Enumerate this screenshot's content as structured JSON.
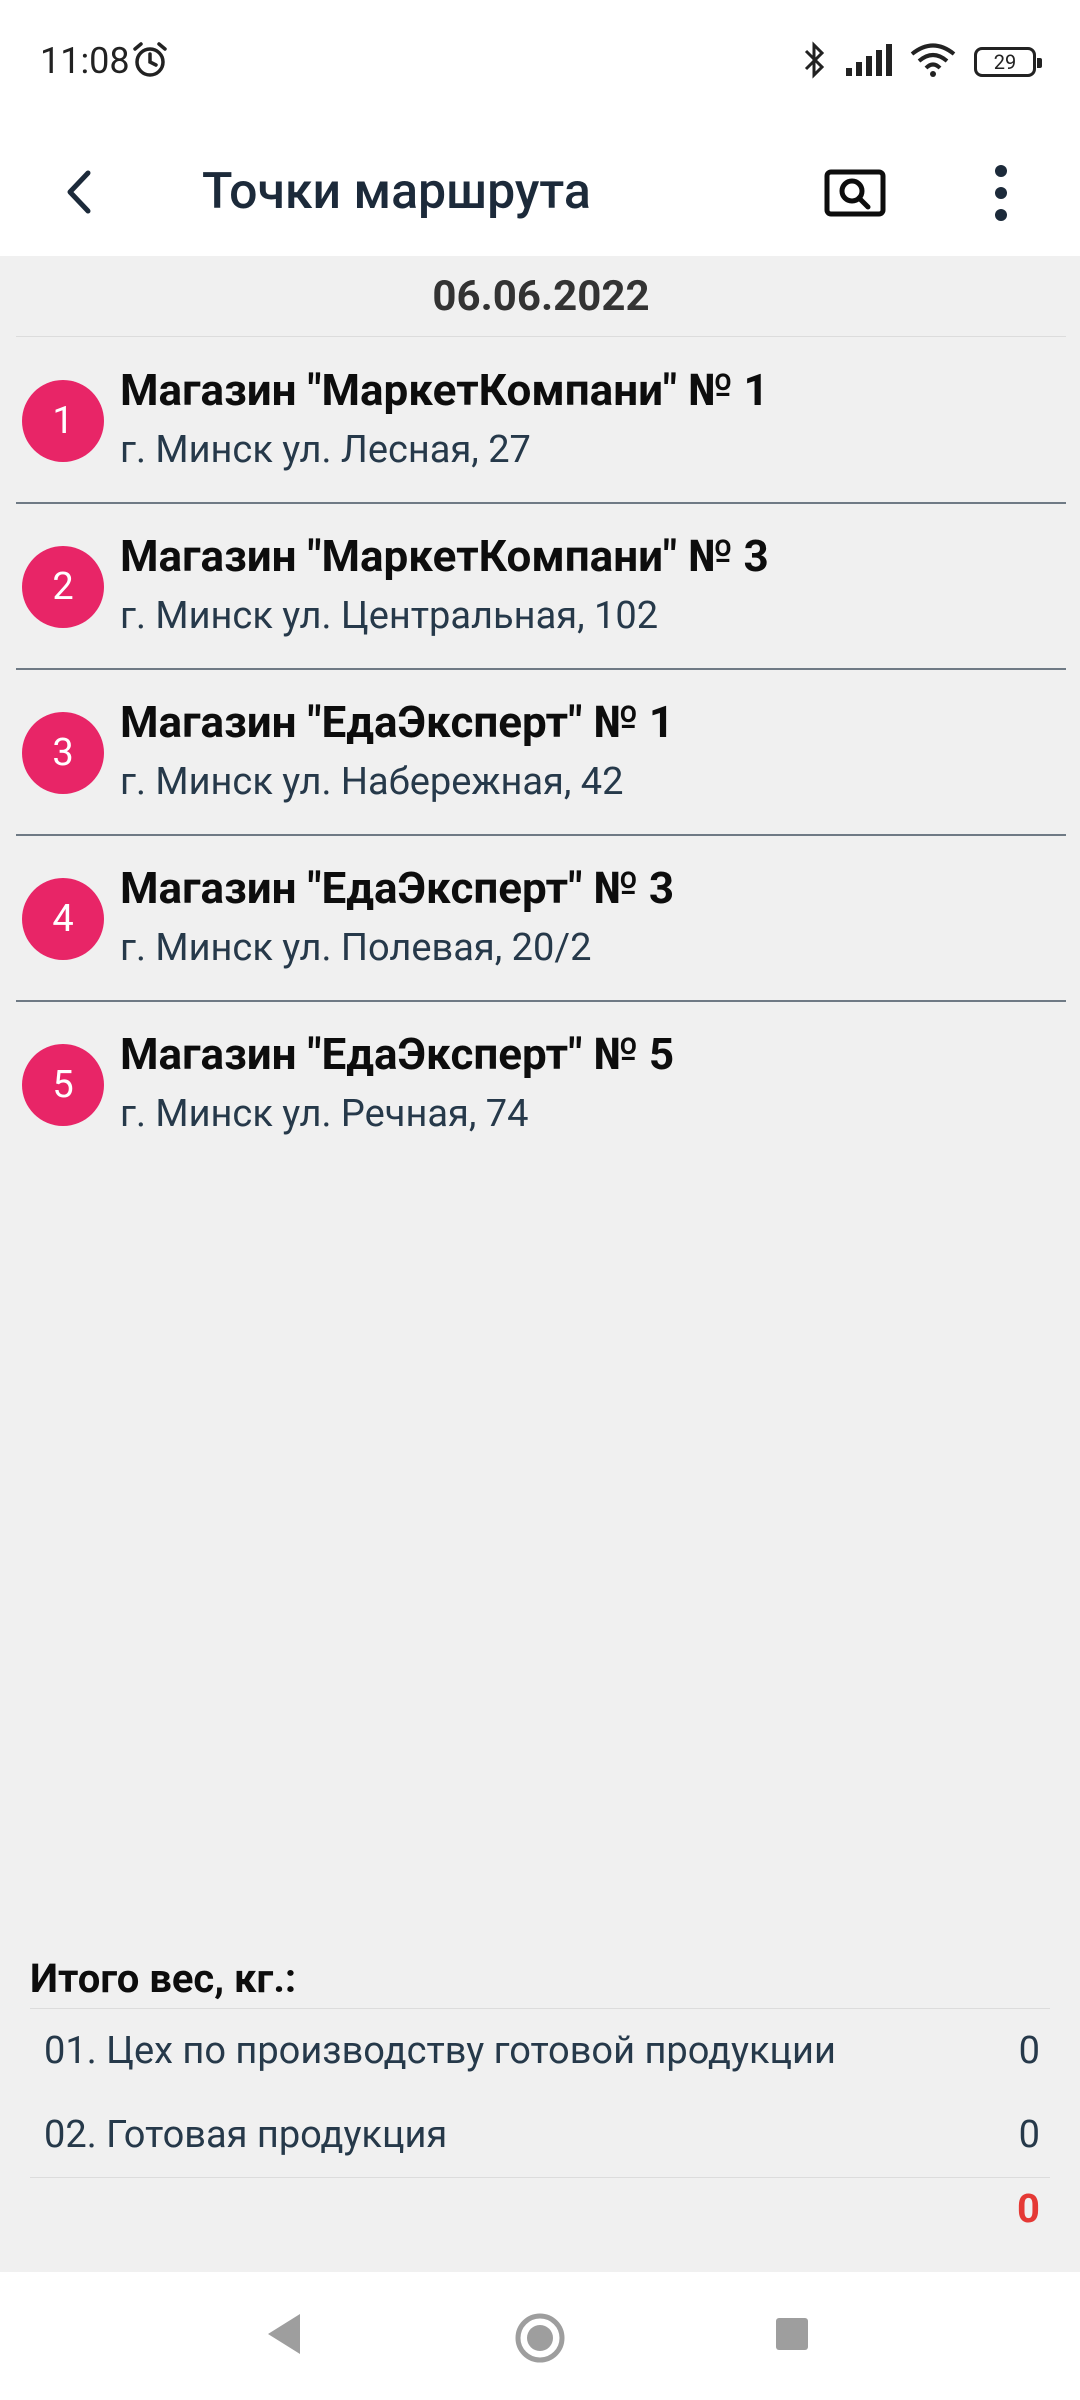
{
  "status_bar": {
    "time": "11:08",
    "battery": "29"
  },
  "app_bar": {
    "title": "Точки маршрута"
  },
  "date": "06.06.2022",
  "route_points": [
    {
      "number": "1",
      "title": "Магазин \"МаркетКомпани\" № 1",
      "address": "г. Минск ул. Лесная, 27"
    },
    {
      "number": "2",
      "title": "Магазин \"МаркетКомпани\" № 3",
      "address": "г. Минск ул. Центральная, 102"
    },
    {
      "number": "3",
      "title": "Магазин \"ЕдаЭксперт\" № 1",
      "address": "г. Минск ул. Набережная, 42"
    },
    {
      "number": "4",
      "title": "Магазин \"ЕдаЭксперт\" № 3",
      "address": "г. Минск ул. Полевая, 20/2"
    },
    {
      "number": "5",
      "title": "Магазин \"ЕдаЭксперт\" № 5",
      "address": "г. Минск ул. Речная, 74"
    }
  ],
  "totals": {
    "title": "Итого вес, кг.:",
    "rows": [
      {
        "label": "01. Цех по производству готовой продукции",
        "value": "0"
      },
      {
        "label": "02. Готовая продукция",
        "value": "0"
      }
    ],
    "sum": "0"
  },
  "colors": {
    "accent": "#e82567",
    "sum": "#e53935"
  },
  "icons": [
    "alarm-icon",
    "bluetooth-icon",
    "signal-icon",
    "wifi-icon",
    "battery-icon",
    "back-arrow-icon",
    "search-icon",
    "more-vert-icon",
    "nav-back-icon",
    "nav-home-icon",
    "nav-recent-icon"
  ]
}
